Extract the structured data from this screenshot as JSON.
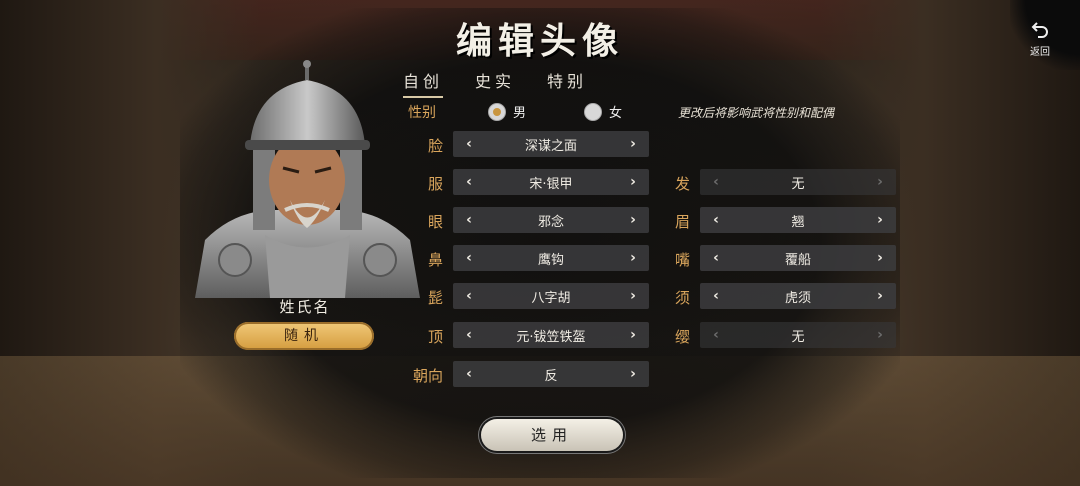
{
  "title": "编辑头像",
  "back": {
    "label": "返回",
    "icon": "undo-arrow-icon"
  },
  "portrait": {
    "name": "姓氏名",
    "random_label": "随机"
  },
  "tabs": [
    {
      "label": "自创",
      "active": true
    },
    {
      "label": "史实",
      "active": false
    },
    {
      "label": "特别",
      "active": false
    }
  ],
  "gender": {
    "label": "性别",
    "options": [
      {
        "label": "男",
        "selected": true
      },
      {
        "label": "女",
        "selected": false
      }
    ],
    "hint": "更改后将影响武将性别和配偶"
  },
  "left_fields": [
    {
      "label": "脸",
      "value": "深谋之面"
    },
    {
      "label": "服",
      "value": "宋·银甲"
    },
    {
      "label": "眼",
      "value": "邪念"
    },
    {
      "label": "鼻",
      "value": "鹰钩"
    },
    {
      "label": "髭",
      "value": "八字胡"
    },
    {
      "label": "顶",
      "value": "元·钹笠铁盔"
    },
    {
      "label": "朝向",
      "value": "反"
    }
  ],
  "right_fields": [
    {
      "label": "发",
      "value": "无",
      "disabled": true
    },
    {
      "label": "眉",
      "value": "翘",
      "disabled": false
    },
    {
      "label": "嘴",
      "value": "覆船",
      "disabled": false
    },
    {
      "label": "须",
      "value": "虎须",
      "disabled": false
    },
    {
      "label": "缨",
      "value": "无",
      "disabled": true
    }
  ],
  "arrows": {
    "left": "‹",
    "right": "›"
  },
  "confirm_label": "选用",
  "colors": {
    "label_gold": "#d9a55c",
    "button_gold": "#e3b25a"
  }
}
